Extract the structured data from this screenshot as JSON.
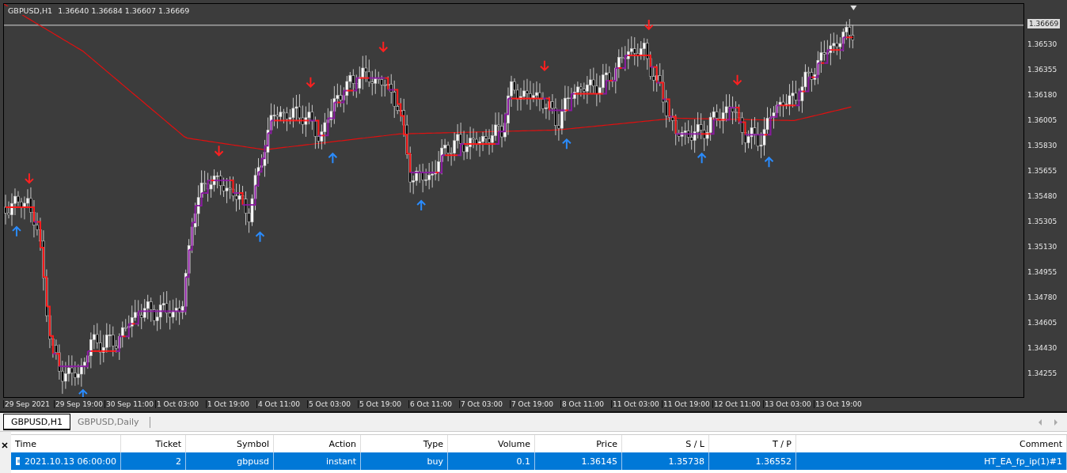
{
  "chart": {
    "symbol": "GBPUSD,H1",
    "quotes": "1.36640 1.36684 1.36607 1.36669",
    "current_price": "1.36669",
    "price_labels": [
      "1.36530",
      "1.36355",
      "1.36180",
      "1.36005",
      "1.35830",
      "1.35655",
      "1.35480",
      "1.35305",
      "1.35130",
      "1.34955",
      "1.34780",
      "1.34605",
      "1.34430",
      "1.34255"
    ],
    "time_labels": [
      "29 Sep 2021",
      "29 Sep 19:00",
      "30 Sep 11:00",
      "1 Oct 03:00",
      "1 Oct 19:00",
      "4 Oct 11:00",
      "5 Oct 03:00",
      "5 Oct 19:00",
      "6 Oct 11:00",
      "7 Oct 03:00",
      "7 Oct 19:00",
      "8 Oct 11:00",
      "11 Oct 03:00",
      "11 Oct 19:00",
      "12 Oct 11:00",
      "13 Oct 03:00",
      "13 Oct 19:00"
    ]
  },
  "tabs": [
    {
      "label": "GBPUSD,H1",
      "selected": true
    },
    {
      "label": "GBPUSD,Daily",
      "selected": false
    }
  ],
  "table": {
    "columns": [
      "Time",
      "Ticket",
      "Symbol",
      "Action",
      "Type",
      "Volume",
      "Price",
      "S / L",
      "T / P",
      "Comment"
    ],
    "rows": [
      {
        "selected": true,
        "cells": [
          "2021.10.13 06:00:00",
          "2",
          "gbpusd",
          "instant",
          "buy",
          "0.1",
          "1.36145",
          "1.35738",
          "1.36552",
          "HT_EA_fp_ip(1)#1"
        ]
      }
    ]
  }
}
